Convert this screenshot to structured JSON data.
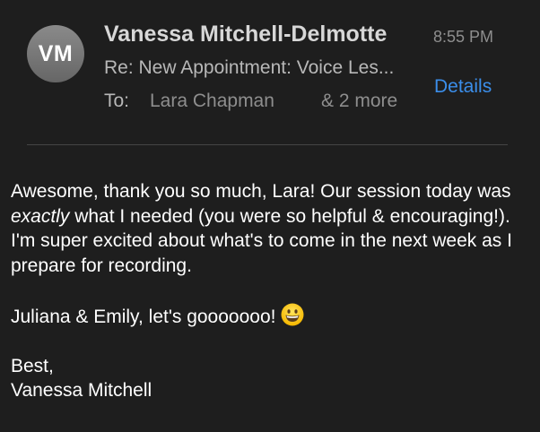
{
  "header": {
    "avatar_initials": "VM",
    "sender_name": "Vanessa Mitchell-Delmotte",
    "time": "8:55 PM",
    "subject": "Re: New Appointment: Voice Les...",
    "details_label": "Details",
    "to_label": "To:",
    "recipient": "Lara Chapman",
    "more_recipients": "& 2 more"
  },
  "message": {
    "p1_before": "Awesome, thank you so much, Lara!  Our session today was ",
    "p1_emphasis": "exactly",
    "p1_after": " what I needed (you were so helpful & encouraging!). I'm super excited about what's to come in the next week as I prepare for recording.",
    "p2_text": "Juliana & Emily, let's gooooooo! ",
    "p2_emoji_icon": "grinning-face-emoji",
    "closing": "Best,",
    "signature": "Vanessa Mitchell"
  },
  "colors": {
    "background": "#1e1e1e",
    "link": "#3b8eea",
    "secondary_text": "#8e8e8e"
  }
}
